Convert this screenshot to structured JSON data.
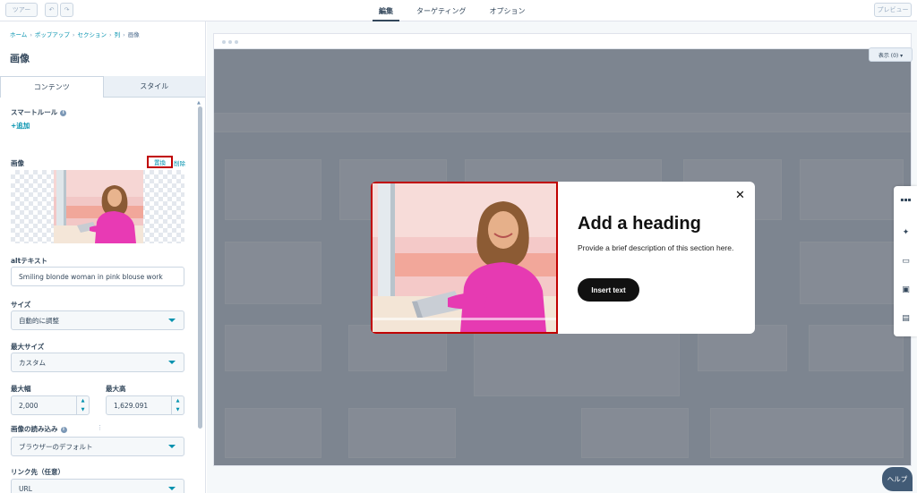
{
  "topbar": {
    "tour_label": "ツアー",
    "undo_icon": "↶",
    "redo_icon": "↷",
    "tabs": [
      {
        "label": "編集",
        "active": true
      },
      {
        "label": "ターゲティング",
        "active": false
      },
      {
        "label": "オプション",
        "active": false
      }
    ],
    "preview_label": "プレビュー"
  },
  "panel": {
    "breadcrumb": [
      "ホーム",
      "ポップアップ",
      "セクション",
      "列",
      "画像"
    ],
    "title": "画像",
    "tabs": [
      "コンテンツ",
      "スタイル"
    ],
    "smart_rules_label": "スマートルール",
    "add_label": "+追加",
    "image_label": "画像",
    "replace_label": "置換",
    "delete_label": "削除",
    "alt_label": "altテキスト",
    "alt_value": "Smiling blonde woman in pink blouse work",
    "size_label": "サイズ",
    "size_value": "自動的に調整",
    "max_size_label": "最大サイズ",
    "max_size_value": "カスタム",
    "max_width_label": "最大幅",
    "max_width_value": "2,000",
    "max_height_label": "最大高",
    "max_height_value": "1,629.091",
    "loading_label": "画像の読み込み",
    "loading_value": "ブラウザーのデフォルト",
    "link_label": "リンク先（任意）",
    "link_value": "URL"
  },
  "canvas": {
    "view_label": "表示 (0) ▾"
  },
  "popup": {
    "heading": "Add a heading",
    "description": "Provide a brief description of this section here.",
    "cta": "Insert text",
    "close_icon": "✕"
  },
  "help_label": "ヘルプ",
  "colors": {
    "accent": "#0091ae",
    "text": "#33475b",
    "highlight": "#c00000",
    "help": "#425b76"
  }
}
